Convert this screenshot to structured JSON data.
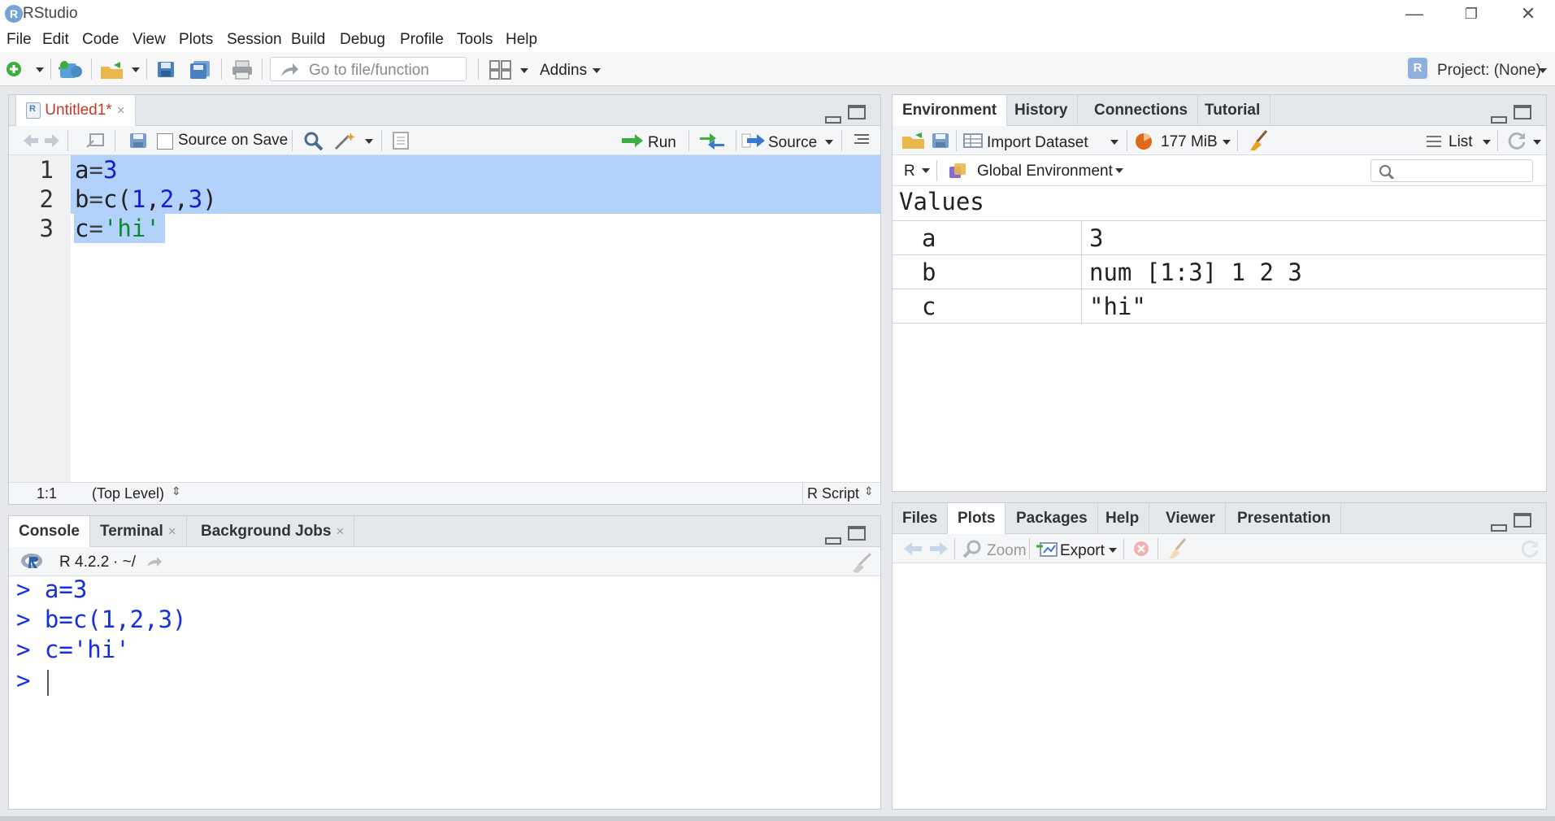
{
  "window": {
    "title": "RStudio",
    "logo_letter": "R",
    "minimize": "—",
    "restore": "❐",
    "close": "✕"
  },
  "menu": [
    "File",
    "Edit",
    "Code",
    "View",
    "Plots",
    "Session",
    "Build",
    "Debug",
    "Profile",
    "Tools",
    "Help"
  ],
  "toolbar": {
    "goto_placeholder": "Go to file/function",
    "addins": "Addins",
    "project": "Project: (None)"
  },
  "editor": {
    "tab_label": "Untitled1*",
    "tab_close": "×",
    "source_on_save": "Source on Save",
    "run_label": "Run",
    "source_label": "Source",
    "line_numbers": [
      "1",
      "2",
      "3"
    ],
    "lines": [
      {
        "parts": [
          "a",
          "=",
          "3"
        ]
      },
      {
        "parts": [
          "b",
          "=",
          "c(",
          "1",
          ",",
          "2",
          ",",
          "3",
          ")"
        ]
      },
      {
        "parts": [
          "c",
          "=",
          "'hi'"
        ]
      }
    ],
    "status_pos": "1:1",
    "status_scope": "(Top Level)",
    "status_type": "R Script"
  },
  "console": {
    "tabs": [
      "Console",
      "Terminal",
      "Background Jobs"
    ],
    "close_mark": "×",
    "version": "R 4.2.2",
    "path": "· ~/",
    "lines": [
      "> a=3",
      "> b=c(1,2,3)",
      "> c='hi'",
      "> "
    ]
  },
  "environment": {
    "tabs": [
      "Environment",
      "History",
      "Connections",
      "Tutorial"
    ],
    "import_dataset": "Import Dataset",
    "memory": "177 MiB",
    "view_mode": "List",
    "language": "R",
    "scope": "Global Environment",
    "section": "Values",
    "rows": [
      {
        "name": "a",
        "value": "3"
      },
      {
        "name": "b",
        "value": "num [1:3] 1 2 3"
      },
      {
        "name": "c",
        "value": "\"hi\""
      }
    ]
  },
  "files": {
    "tabs": [
      "Files",
      "Plots",
      "Packages",
      "Help",
      "Viewer",
      "Presentation"
    ],
    "zoom": "Zoom",
    "export": "Export"
  },
  "colors": {
    "accent_blue": "#1530e0",
    "selection": "#b3d2fb",
    "string_green": "#0a8a2a",
    "number_blue": "#1a1ad6"
  }
}
